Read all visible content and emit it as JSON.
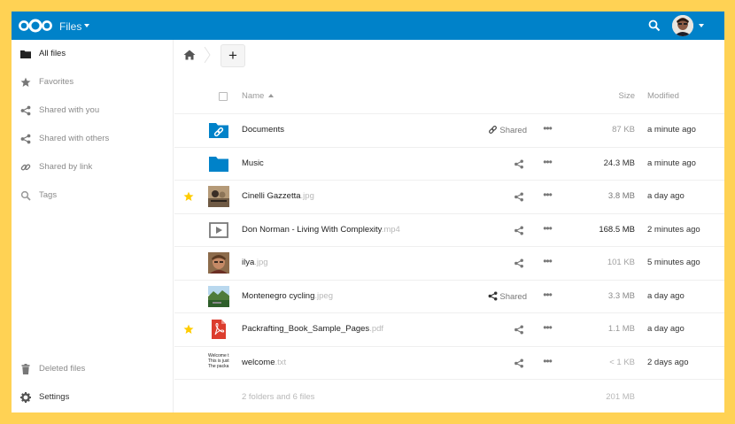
{
  "header": {
    "app_name": "Files",
    "brand_color": "#0082c9",
    "frame_color": "#ffd254"
  },
  "sidebar": {
    "items": [
      {
        "label": "All files",
        "icon": "folder-icon",
        "active": true
      },
      {
        "label": "Favorites",
        "icon": "star-icon"
      },
      {
        "label": "Shared with you",
        "icon": "share-icon"
      },
      {
        "label": "Shared with others",
        "icon": "share-icon"
      },
      {
        "label": "Shared by link",
        "icon": "link-icon"
      },
      {
        "label": "Tags",
        "icon": "tag-icon"
      }
    ],
    "bottom": [
      {
        "label": "Deleted files",
        "icon": "trash-icon"
      },
      {
        "label": "Settings",
        "icon": "gear-icon"
      }
    ]
  },
  "toolbar": {
    "add_label": "+"
  },
  "table": {
    "headers": {
      "name": "Name",
      "size": "Size",
      "modified": "Modified"
    },
    "rows": [
      {
        "name": "Documents",
        "ext": "",
        "type": "folder-link",
        "favorite": false,
        "shared_label": "Shared",
        "shared_icon": "link-icon",
        "size": "87 KB",
        "modified": "a minute ago",
        "size_color": "#9a9a9a"
      },
      {
        "name": "Music",
        "ext": "",
        "type": "folder",
        "favorite": false,
        "shared_label": "",
        "size": "24.3 MB",
        "modified": "a minute ago",
        "size_color": "#333333"
      },
      {
        "name": "Cinelli Gazzetta",
        "ext": ".jpg",
        "type": "image-bike",
        "favorite": true,
        "shared_label": "",
        "size": "3.8 MB",
        "modified": "a day ago",
        "size_color": "#777777"
      },
      {
        "name": "Don Norman - Living With Complexity",
        "ext": ".mp4",
        "type": "video",
        "favorite": false,
        "shared_label": "",
        "size": "168.5 MB",
        "modified": "2 minutes ago",
        "size_color": "#222222"
      },
      {
        "name": "ilya",
        "ext": ".jpg",
        "type": "image-person",
        "favorite": false,
        "shared_label": "",
        "size": "101 KB",
        "modified": "5 minutes ago",
        "size_color": "#a0a0a0"
      },
      {
        "name": "Montenegro cycling",
        "ext": ".jpeg",
        "type": "image-landscape",
        "favorite": false,
        "shared_label": "Shared",
        "shared_icon": "share-icon",
        "size": "3.3 MB",
        "modified": "a day ago",
        "size_color": "#8a8a8a"
      },
      {
        "name": "Packrafting_Book_Sample_Pages",
        "ext": ".pdf",
        "type": "pdf",
        "favorite": true,
        "shared_label": "",
        "size": "1.1 MB",
        "modified": "a day ago",
        "size_color": "#999999"
      },
      {
        "name": "welcome",
        "ext": ".txt",
        "type": "text",
        "favorite": false,
        "shared_label": "",
        "size": "< 1 KB",
        "modified": "2 days ago",
        "size_color": "#b0b0b0",
        "preview_lines": [
          "Welcome t",
          "This is just",
          "The packa"
        ]
      }
    ],
    "summary": {
      "count": "2 folders and 6 files",
      "total": "201 MB"
    }
  }
}
